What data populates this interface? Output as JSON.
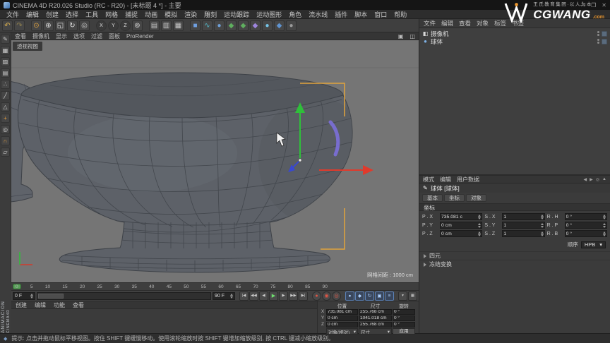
{
  "window": {
    "title": "CINEMA 4D R20.026 Studio (RC - R20) - [未标题 4 *] - 主要",
    "minimize": "—",
    "maximize": "❐",
    "close": "✕"
  },
  "menu_bar": [
    "文件",
    "编辑",
    "创建",
    "选择",
    "工具",
    "网格",
    "捕捉",
    "动画",
    "模拟",
    "渲染",
    "雕刻",
    "运动跟踪",
    "运动图形",
    "角色",
    "流水线",
    "插件",
    "脚本",
    "窗口",
    "帮助"
  ],
  "toolbar": [
    {
      "name": "undo-icon",
      "glyph": "↶",
      "color": "#e6b84f"
    },
    {
      "name": "redo-icon",
      "glyph": "↷",
      "color": "#96854e"
    },
    {
      "name": "separator",
      "glyph": "",
      "cls": "sep"
    },
    {
      "name": "live-selection-icon",
      "glyph": "⊙",
      "color": "#e2a43e"
    },
    {
      "name": "move-tool-icon",
      "glyph": "⊕",
      "color": "#e0e0e0"
    },
    {
      "name": "scale-tool-icon",
      "glyph": "◱",
      "color": "#e0e0e0"
    },
    {
      "name": "rotate-tool-icon",
      "glyph": "↻",
      "color": "#e0e0e0"
    },
    {
      "name": "last-tool-icon",
      "glyph": "◎",
      "color": "#c8c8c8"
    },
    {
      "name": "separator",
      "glyph": "",
      "cls": "sep"
    },
    {
      "name": "x-axis-lock-icon",
      "glyph": "X",
      "cls": "axis"
    },
    {
      "name": "y-axis-lock-icon",
      "glyph": "Y",
      "cls": "axis"
    },
    {
      "name": "z-axis-lock-icon",
      "glyph": "Z",
      "cls": "axis"
    },
    {
      "name": "coordinate-system-icon",
      "glyph": "⊚",
      "color": "#d8d8d8"
    },
    {
      "name": "separator",
      "glyph": "",
      "cls": "sep"
    },
    {
      "name": "render-view-icon",
      "glyph": "▤",
      "color": "#c9c9c9"
    },
    {
      "name": "render-settings-icon",
      "glyph": "▥",
      "color": "#c9c9c9"
    },
    {
      "name": "render-picture-viewer-icon",
      "glyph": "▦",
      "color": "#c9c9c9"
    },
    {
      "name": "separator",
      "glyph": "",
      "cls": "sep"
    },
    {
      "name": "add-cube-icon",
      "glyph": "■",
      "color": "#6f9fe0"
    },
    {
      "name": "spline-pen-icon",
      "glyph": "∿",
      "color": "#52b9c9"
    },
    {
      "name": "subdivision-surface-icon",
      "glyph": "●",
      "color": "#6fa0d8"
    },
    {
      "name": "generator-icon",
      "glyph": "◆",
      "color": "#5fae5f"
    },
    {
      "name": "modeling-icon",
      "glyph": "◆",
      "color": "#5fae5f"
    },
    {
      "name": "deformer-icon",
      "glyph": "◆",
      "color": "#9d85dd"
    },
    {
      "name": "environment-icon",
      "glyph": "●",
      "color": "#74c4e8"
    },
    {
      "name": "mograph-icon",
      "glyph": "◆",
      "color": "#5f93d0"
    },
    {
      "name": "volume-icon",
      "glyph": "●",
      "color": "#9a9a9a"
    }
  ],
  "palette": [
    {
      "name": "make-editable-icon",
      "glyph": "✎",
      "color": "#cfcfcf"
    },
    {
      "name": "model-mode-icon",
      "glyph": "▦",
      "color": "#cfcfcf"
    },
    {
      "name": "texture-mode-icon",
      "glyph": "▨",
      "color": "#cfcfcf"
    },
    {
      "name": "workplane-mode-icon",
      "glyph": "▤",
      "color": "#cfcfcf"
    },
    {
      "name": "points-mode-icon",
      "glyph": "∴",
      "color": "#cfcfcf"
    },
    {
      "name": "edges-mode-icon",
      "glyph": "╱",
      "color": "#cfcfcf"
    },
    {
      "name": "polygons-mode-icon",
      "glyph": "△",
      "color": "#cfcfcf"
    },
    {
      "name": "enable-axis-icon",
      "glyph": "+",
      "color": "#e09a3e"
    },
    {
      "name": "viewport-solo-icon",
      "glyph": "◎",
      "color": "#cfcfcf"
    },
    {
      "name": "enable-snap-icon",
      "glyph": "∩",
      "color": "#e09a3e"
    },
    {
      "name": "workplane-snap-icon",
      "glyph": "▱",
      "color": "#cfcfcf"
    }
  ],
  "viewport": {
    "menus": [
      "查看",
      "摄像机",
      "显示",
      "选项",
      "过滤",
      "面板",
      "ProRender"
    ],
    "panel_icons": [
      {
        "name": "single-view-icon",
        "glyph": "▣"
      },
      {
        "name": "four-view-icon",
        "glyph": "◫"
      }
    ],
    "label": "透视视图",
    "grid": "网格间距 : 1000 cm"
  },
  "object_manager": {
    "menus": [
      "文件",
      "编辑",
      "查看",
      "对象",
      "标签",
      "书签"
    ],
    "rows": [
      {
        "name": "object-row-camera",
        "glyph": "◧",
        "color": "#d8d8d8",
        "label": "摄像机"
      },
      {
        "name": "object-row-sphere",
        "glyph": "●",
        "color": "#7fb3e8",
        "label": "球体"
      }
    ]
  },
  "logo": {
    "tagline": "王氏教育集团·以人为本",
    "brand": "CGWANG",
    "domain": ".com"
  },
  "attributes": {
    "menus": [
      "模式",
      "编辑",
      "用户数据"
    ],
    "icons": [
      {
        "name": "history-back-icon",
        "glyph": "◀"
      },
      {
        "name": "history-forward-icon",
        "glyph": "▶"
      },
      {
        "name": "filter-icon",
        "glyph": "◎"
      },
      {
        "name": "lock-icon",
        "glyph": "▲"
      }
    ],
    "object_title": "球体 [球体]",
    "tabs": [
      "基本",
      "坐标",
      "对象"
    ],
    "section": "坐标",
    "rows": [
      {
        "pl": "P . X",
        "pv": "735.081 c",
        "sl": "S . X",
        "sv": "1",
        "rl": "R . H",
        "rv": "0 °"
      },
      {
        "pl": "P . Y",
        "pv": "0 cm",
        "sl": "S . Y",
        "sv": "1",
        "rl": "R . P",
        "rv": "0 °"
      },
      {
        "pl": "P . Z",
        "pv": "0 cm",
        "sl": "S . Z",
        "sv": "1",
        "rl": "R . B",
        "rv": "0 °"
      }
    ],
    "order_label": "顺序",
    "order_value": "HPB",
    "groups": [
      "四元",
      "冻结变换"
    ]
  },
  "timeline": {
    "ticks": [
      "0",
      "5",
      "10",
      "15",
      "20",
      "25",
      "30",
      "35",
      "40",
      "45",
      "50",
      "55",
      "60",
      "65",
      "70",
      "75",
      "80",
      "85",
      "90"
    ]
  },
  "transport": {
    "current": "0 F",
    "end": "90 F",
    "buttons": [
      {
        "name": "go-to-start-button",
        "glyph": "|◀"
      },
      {
        "name": "previous-key-button",
        "glyph": "◀◀"
      },
      {
        "name": "previous-frame-button",
        "glyph": "◀"
      },
      {
        "name": "play-button",
        "glyph": "▶",
        "cls": "play"
      },
      {
        "name": "next-frame-button",
        "glyph": "▶"
      },
      {
        "name": "next-key-button",
        "glyph": "▶▶"
      },
      {
        "name": "go-to-end-button",
        "glyph": "▶|"
      }
    ],
    "record": [
      {
        "name": "record-keyframe-button",
        "glyph": "●",
        "cls": "rec"
      },
      {
        "name": "autokey-button",
        "glyph": "◉",
        "cls": "rec"
      },
      {
        "name": "record-options-button",
        "glyph": "◎",
        "cls": "rec"
      }
    ],
    "keys": [
      {
        "name": "key-position-button",
        "glyph": "●",
        "cls": "key"
      },
      {
        "name": "key-scale-button",
        "glyph": "◆",
        "cls": "key"
      },
      {
        "name": "key-rotation-button",
        "glyph": "↻",
        "cls": "key"
      },
      {
        "name": "key-parameter-button",
        "glyph": "▣",
        "cls": "key"
      },
      {
        "name": "key-pla-button",
        "glyph": "≡",
        "cls": "key"
      }
    ],
    "extra": [
      {
        "name": "keyframe-presets-button",
        "glyph": "▾"
      },
      {
        "name": "timeline-layout-button",
        "glyph": "▦"
      }
    ]
  },
  "material_manager": {
    "menus": [
      "创建",
      "编辑",
      "功能",
      "查看"
    ]
  },
  "coordinates": {
    "headers": [
      "位置",
      "尺寸",
      "旋转"
    ],
    "rows": [
      {
        "axis": "X",
        "pos": "735.081 cm",
        "size": "255.768 cm",
        "rot": "0 °"
      },
      {
        "axis": "Y",
        "pos": "0 cm",
        "size": "1041.018 cm",
        "rot": "0 °"
      },
      {
        "axis": "Z",
        "pos": "0 cm",
        "size": "255.768 cm",
        "rot": "0 °"
      }
    ],
    "mode_position": "对象(相对)",
    "mode_size": "尺寸",
    "apply": "应用"
  },
  "status": {
    "hint": "提示: 点击并拖动鼠标平移视图。按住 SHIFT 键缓慢移动。使用滚轮缩放时按 SHIFT 键增加缩放级别, 按 CTRL 键减小缩放级别。"
  },
  "watermark": {
    "line1": "ANIMACION",
    "line2": "CINEMA4D"
  }
}
